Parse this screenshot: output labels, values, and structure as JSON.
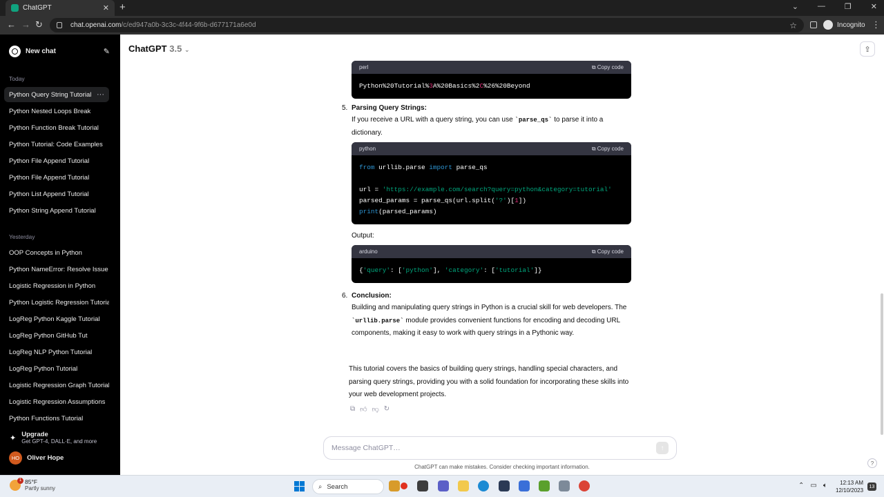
{
  "browser": {
    "tab_title": "ChatGPT",
    "url_host": "chat.openai.com",
    "url_path": "/c/ed947a0b-3c3c-4f44-9f6b-d677171a6e0d",
    "incognito_label": "Incognito"
  },
  "sidebar": {
    "new_chat": "New chat",
    "today_label": "Today",
    "today_items": [
      "Python Query String Tutorial",
      "Python Nested Loops Break",
      "Python Function Break Tutorial",
      "Python Tutorial: Code Examples",
      "Python File Append Tutorial",
      "Python File Append Tutorial",
      "Python List Append Tutorial",
      "Python String Append Tutorial"
    ],
    "yesterday_label": "Yesterday",
    "yesterday_items": [
      "OOP Concepts in Python",
      "Python NameError: Resolve Issue",
      "Logistic Regression in Python",
      "Python Logistic Regression Tutorial",
      "LogReg Python Kaggle Tutorial",
      "LogReg Python GitHub Tut",
      "LogReg NLP Python Tutorial",
      "LogReg Python Tutorial",
      "Logistic Regression Graph Tutorial",
      "Logistic Regression Assumptions",
      "Python Functions Tutorial"
    ],
    "upgrade_title": "Upgrade",
    "upgrade_sub": "Get GPT-4, DALL·E, and more",
    "user_initials": "HO",
    "user_name": "Oliver Hope"
  },
  "header": {
    "model": "ChatGPT",
    "version": "3.5"
  },
  "conversation": {
    "code1_lang": "perl",
    "copy_label": "Copy code",
    "item5_num": "5.",
    "item5_title": "Parsing Query Strings:",
    "item5_text_a": "If you receive a URL with a query string, you can use ",
    "item5_code": "`parse_qs`",
    "item5_text_b": " to parse it into a dictionary.",
    "code2_lang": "python",
    "output_label": "Output:",
    "code3_lang": "arduino",
    "item6_num": "6.",
    "item6_title": "Conclusion:",
    "item6_text_a": "Building and manipulating query strings in Python is a crucial skill for web developers. The ",
    "item6_code": "`urllib.parse`",
    "item6_text_b": " module provides convenient functions for encoding and decoding URL components, making it easy to work with query strings in a Pythonic way.",
    "summary": "This tutorial covers the basics of building query strings, handling special characters, and parsing query strings, providing you with a solid foundation for incorporating these skills into your web development projects."
  },
  "composer": {
    "placeholder": "Message ChatGPT…",
    "disclaimer": "ChatGPT can make mistakes. Consider checking important information."
  },
  "taskbar": {
    "temp": "85°F",
    "condition": "Partly sunny",
    "weather_badge": "1",
    "search_label": "Search",
    "time": "12:13 AM",
    "date": "12/10/2023",
    "notif_count": "13"
  },
  "colors": {
    "sidebar_bg": "#000000",
    "code_header": "#343541",
    "keyword": "#2e95d3",
    "string": "#00a67d",
    "number": "#df3079",
    "avatar": "#d15a1e"
  }
}
